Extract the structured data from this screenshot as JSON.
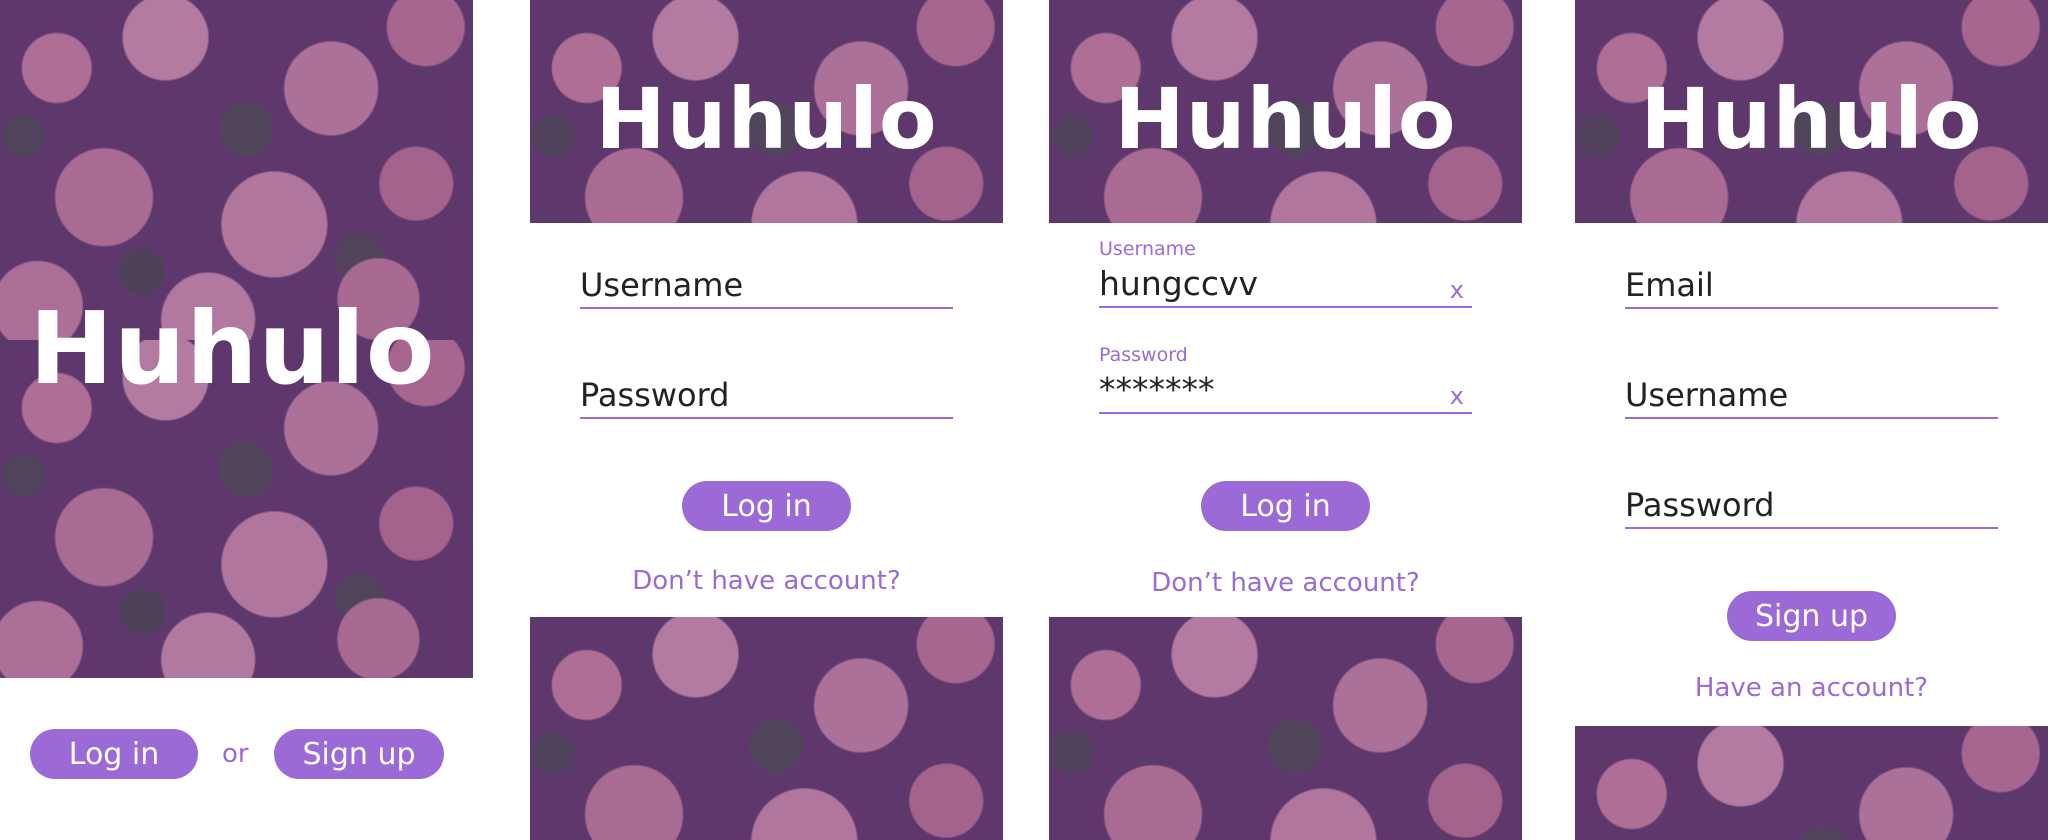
{
  "app": {
    "logo_text": "Huhulo",
    "accent_color": "#9b6ad6"
  },
  "splash": {
    "login_label": "Log in",
    "or_text": "or",
    "signup_label": "Sign up"
  },
  "login_empty": {
    "username_placeholder": "Username",
    "password_placeholder": "Password",
    "login_label": "Log in",
    "no_account_link": "Don’t have account?"
  },
  "login_filled": {
    "username_label": "Username",
    "username_value": "hungccvv",
    "password_label": "Password",
    "password_value": "*******",
    "clear_glyph": "x",
    "login_label": "Log in",
    "no_account_link": "Don’t have account?"
  },
  "signup": {
    "email_placeholder": "Email",
    "username_placeholder": "Username",
    "password_placeholder": "Password",
    "signup_label": "Sign up",
    "have_account_link": "Have an account?"
  }
}
